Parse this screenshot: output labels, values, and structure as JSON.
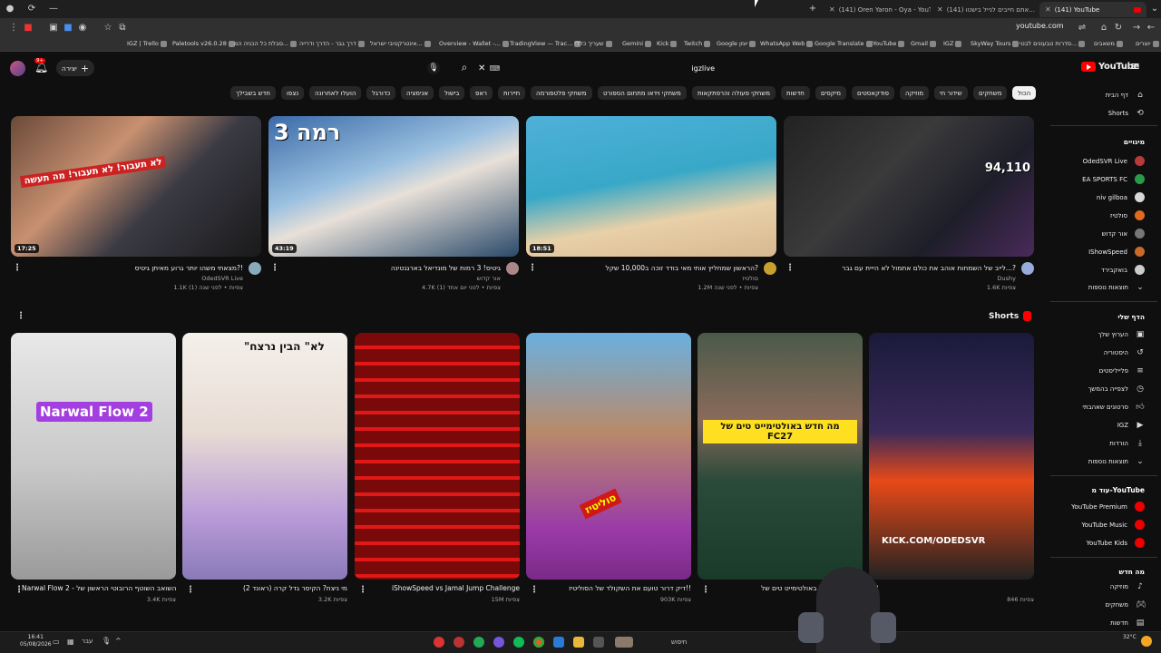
{
  "browser": {
    "tabs": [
      {
        "label": "(141) Oren Yaron - Oya - YouT",
        "active": false
      },
      {
        "label": "(141) אתם חייבים לנייל בישטו...",
        "active": false
      },
      {
        "label": "(141) YouTube",
        "active": true
      }
    ],
    "url": "youtube.com",
    "bookmarks": [
      "IGZ | Trello",
      "Paletools v26.0.28",
      "סבלת כל הכניה המ...",
      "דרך גבר - הדרך ודרייה",
      "אינטרקטיבי ישראל...",
      "Overview - Wallet -...",
      "TradingView — Trac...",
      "שעריך כללי",
      "Gemini",
      "Kick",
      "Twitch",
      "Google יומן",
      "WhatsApp Web",
      "Google Translate",
      "YouTube",
      "Gmail",
      "IGZ",
      "SkyWay Tours",
      "סדרות טבעונים לבטי...",
      "משאבים",
      "יוצרים"
    ]
  },
  "header": {
    "logo_text": "YouTube",
    "create_label": "יצירה",
    "search_value": "igzlive",
    "notification_count": "9+"
  },
  "chips": [
    "הכול",
    "משחקים",
    "שידור חי",
    "מוזיקה",
    "פודקאסטים",
    "מיקסים",
    "חדשות",
    "משחקי פעולה והרפתקאות",
    "משחקי וידאו מתחום הספורט",
    "משחקי פלטפורמה",
    "תיירות",
    "ראפ",
    "בישול",
    "אנימציה",
    "כדורגל",
    "הועלו לאחרונה",
    "נצפו",
    "חדש בשבילך"
  ],
  "sidebar": {
    "home": "דף הבית",
    "shorts": "Shorts",
    "subs_header": "מינויים",
    "channels": [
      "OdedSVR Live",
      "EA SPORTS FC",
      "niv gilboa",
      "סולטיז",
      "אור קדוש",
      "IShowSpeed",
      "בואקבירד"
    ],
    "show_more": "תוצאות נוספות",
    "you_header": "הדף שלי",
    "you_items": [
      "הערוץ שלך",
      "היסטוריה",
      "פלייליסטים",
      "לצפייה בהמשך",
      "סרטונים שאהבתי",
      "IGZ",
      "הורדות",
      "תוצאות נוספות"
    ],
    "more_header": "עוד מ-YouTube",
    "more_items": [
      "YouTube Premium",
      "YouTube Music",
      "YouTube Kids"
    ],
    "whats_new": "מה חדש",
    "explore_items": [
      "מוזיקה",
      "משחקים",
      "חדשות"
    ]
  },
  "videos": [
    {
      "title": "מצאתי משהו יותר גרוע מאיתן גיטיס?!",
      "channel": "OdedSVR Live",
      "meta": "1.1K צפיות • לפני שנה (1)",
      "duration": "17:25",
      "thumb_text": "לא תעבור! לא תעבור! מה תעשה"
    },
    {
      "title": "גיטיס! 3 רמות של מונדיאל בארגנטינה",
      "channel": "אור קדוש",
      "meta": "4.7K צפיות • לפני יום אחד (1)",
      "duration": "43:19",
      "thumb_text": "רמה 3"
    },
    {
      "title": "הראשון שמחליץ אותי מאי בודד זוכה ב10,000 שקל?",
      "channel": "סולטיז",
      "meta": "1.2M צפיות • לפני שנה",
      "duration": "18:51",
      "thumb_text": ""
    },
    {
      "title": "לייב של השמחות אוהב את כולם אתמול לא הייית עם גבר...?",
      "channel": "Dushy",
      "meta": "1.6K צפיות",
      "duration": "",
      "thumb_text": "94,110"
    }
  ],
  "shorts": {
    "header": "Shorts",
    "items": [
      {
        "title": "Narwal Flow 2 - השואב השוטף הרובוטי הראשון של...",
        "views": "3.4K צפיות",
        "thumb_text": "Narwal Flow 2"
      },
      {
        "title": "מי ניצח? הקיסר גדל קרה (ראונד 2)",
        "views": "3.2K צפיות",
        "thumb_text": "\"לא\" הבין נרצח"
      },
      {
        "title": "iShowSpeed vs Jamal Jump Challenge",
        "views": "15M צפיות",
        "thumb_text": ""
      },
      {
        "title": "דיק דרור טועם את השקולד של הסוליטיז!!",
        "views": "903K צפיות",
        "thumb_text": "סוליטיז"
      },
      {
        "title": "מה חדש באולטימייט טים של FC27",
        "views": "",
        "thumb_text": "מה חדש באולטימייט טים של FC27"
      },
      {
        "title": "",
        "views": "846 צפיות",
        "thumb_text": "KICK.COM/ODEDSVR"
      }
    ]
  },
  "taskbar": {
    "time": "16:41",
    "date": "05/08/2026",
    "weather": "32°C",
    "lang": "עבר",
    "search_label": "חיפוש"
  },
  "colors": {
    "bg": "#0f0f0f",
    "accent": "#ff0000",
    "chip": "#272727"
  }
}
